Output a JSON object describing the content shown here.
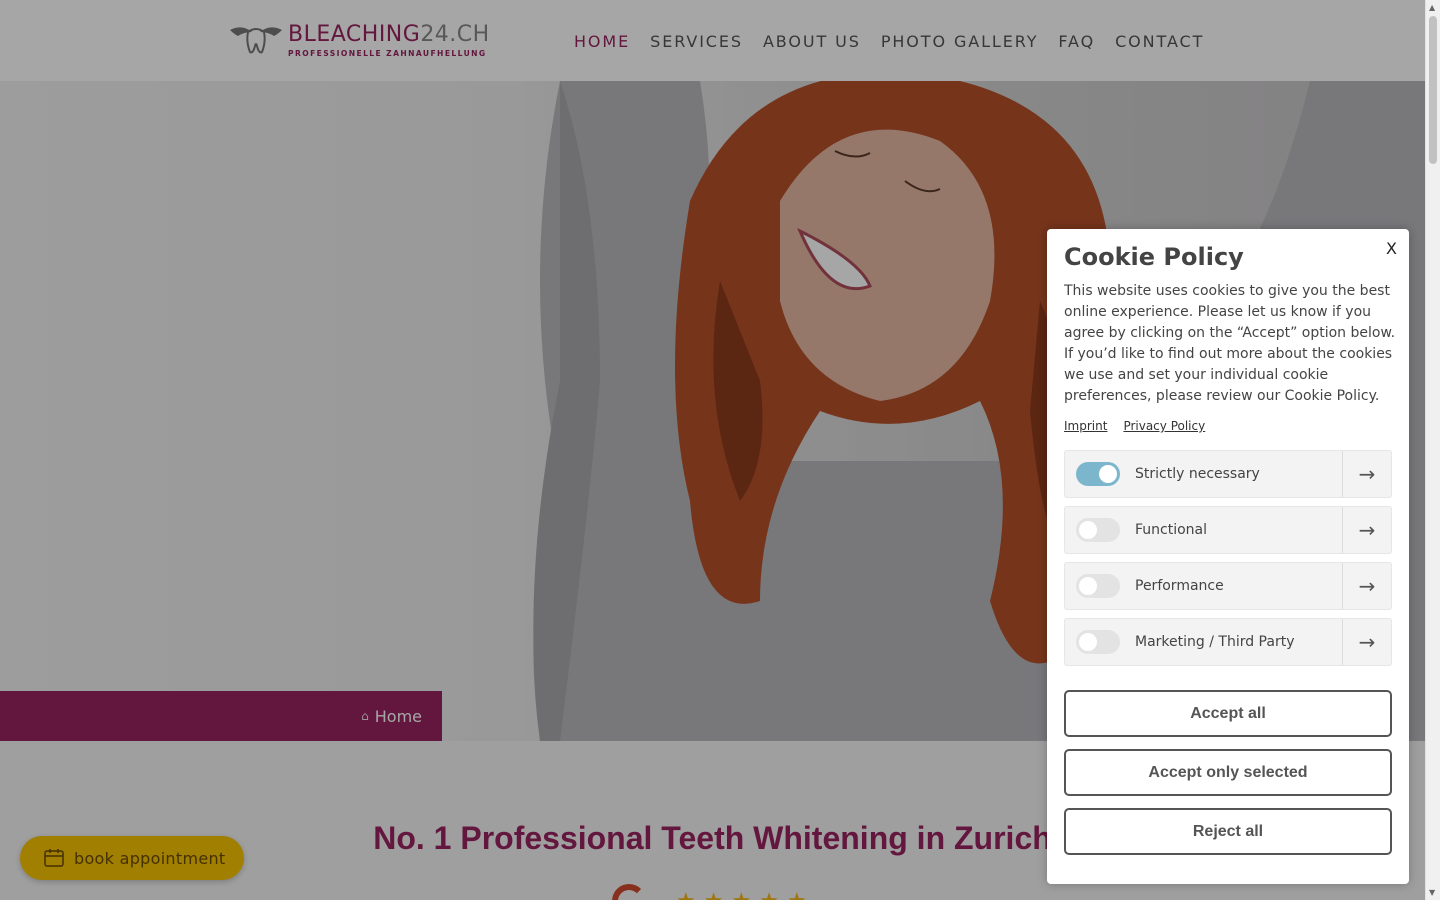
{
  "header": {
    "logo": {
      "title_main": "BLEACHING",
      "title_suffix": "24.CH",
      "subtitle": "PROFESSIONELLE ZAHNAUFHELLUNG"
    },
    "nav": [
      {
        "label": "HOME",
        "active": true
      },
      {
        "label": "SERVICES",
        "active": false
      },
      {
        "label": "ABOUT US",
        "active": false
      },
      {
        "label": "PHOTO GALLERY",
        "active": false
      },
      {
        "label": "FAQ",
        "active": false
      },
      {
        "label": "CONTACT",
        "active": false
      }
    ]
  },
  "hero": {
    "breadcrumb": {
      "icon": "home-icon",
      "label": "Home"
    }
  },
  "main": {
    "heading": "No. 1 Professional Teeth Whitening in Zurich",
    "rating": {
      "icon": "google-icon",
      "stars": 5
    }
  },
  "book_button": {
    "icon": "calendar-icon",
    "label": "book appointment"
  },
  "cookie": {
    "close_label": "X",
    "title": "Cookie Policy",
    "body": "This website uses cookies to give you the best online experience. Please let us know if you agree by clicking on the “Accept” option below. If you’d like to find out more about the cookies we use and set your individual cookie preferences, please review our Cookie Policy.",
    "links": [
      "Imprint",
      "Privacy Policy"
    ],
    "categories": [
      {
        "label": "Strictly necessary",
        "enabled": true
      },
      {
        "label": "Functional",
        "enabled": false
      },
      {
        "label": "Performance",
        "enabled": false
      },
      {
        "label": "Marketing / Third Party",
        "enabled": false
      }
    ],
    "buttons": {
      "accept_all": "Accept all",
      "accept_selected": "Accept only selected",
      "reject_all": "Reject all"
    }
  },
  "colors": {
    "brand": "#9a2460",
    "toggle_on": "#7cb6cc",
    "cta": "#f7c400"
  }
}
